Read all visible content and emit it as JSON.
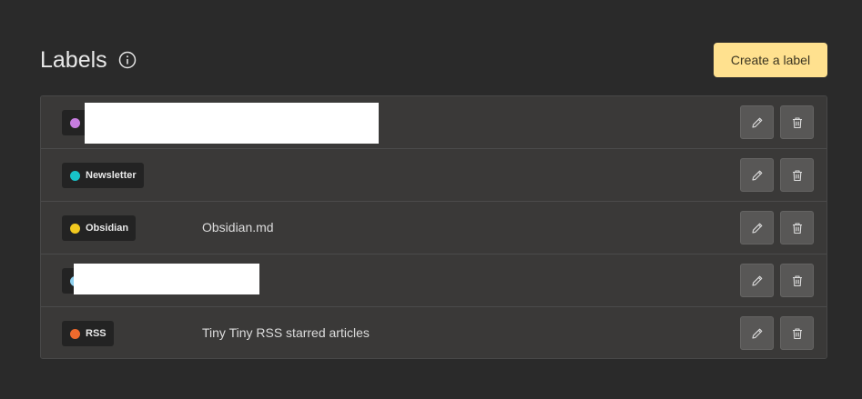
{
  "header": {
    "title": "Labels",
    "info_icon": "info-circle-icon",
    "create_button": "Create a label"
  },
  "colors": {
    "background": "#2a2a2a",
    "row_background": "#3a3938",
    "create_button_bg": "#ffe18f",
    "chip_bg": "#232323"
  },
  "labels": [
    {
      "name": "",
      "color": "#c77de0",
      "description": "",
      "redacted": true
    },
    {
      "name": "Newsletter",
      "color": "#18c2c9",
      "description": ""
    },
    {
      "name": "Obsidian",
      "color": "#f2c91f",
      "description": "Obsidian.md"
    },
    {
      "name": "",
      "color": "#8fd1ef",
      "description": "",
      "redacted": true
    },
    {
      "name": "RSS",
      "color": "#ef6a2d",
      "description": "Tiny Tiny RSS starred articles"
    }
  ],
  "row_actions": {
    "edit_icon": "pencil-icon",
    "delete_icon": "trash-icon"
  }
}
